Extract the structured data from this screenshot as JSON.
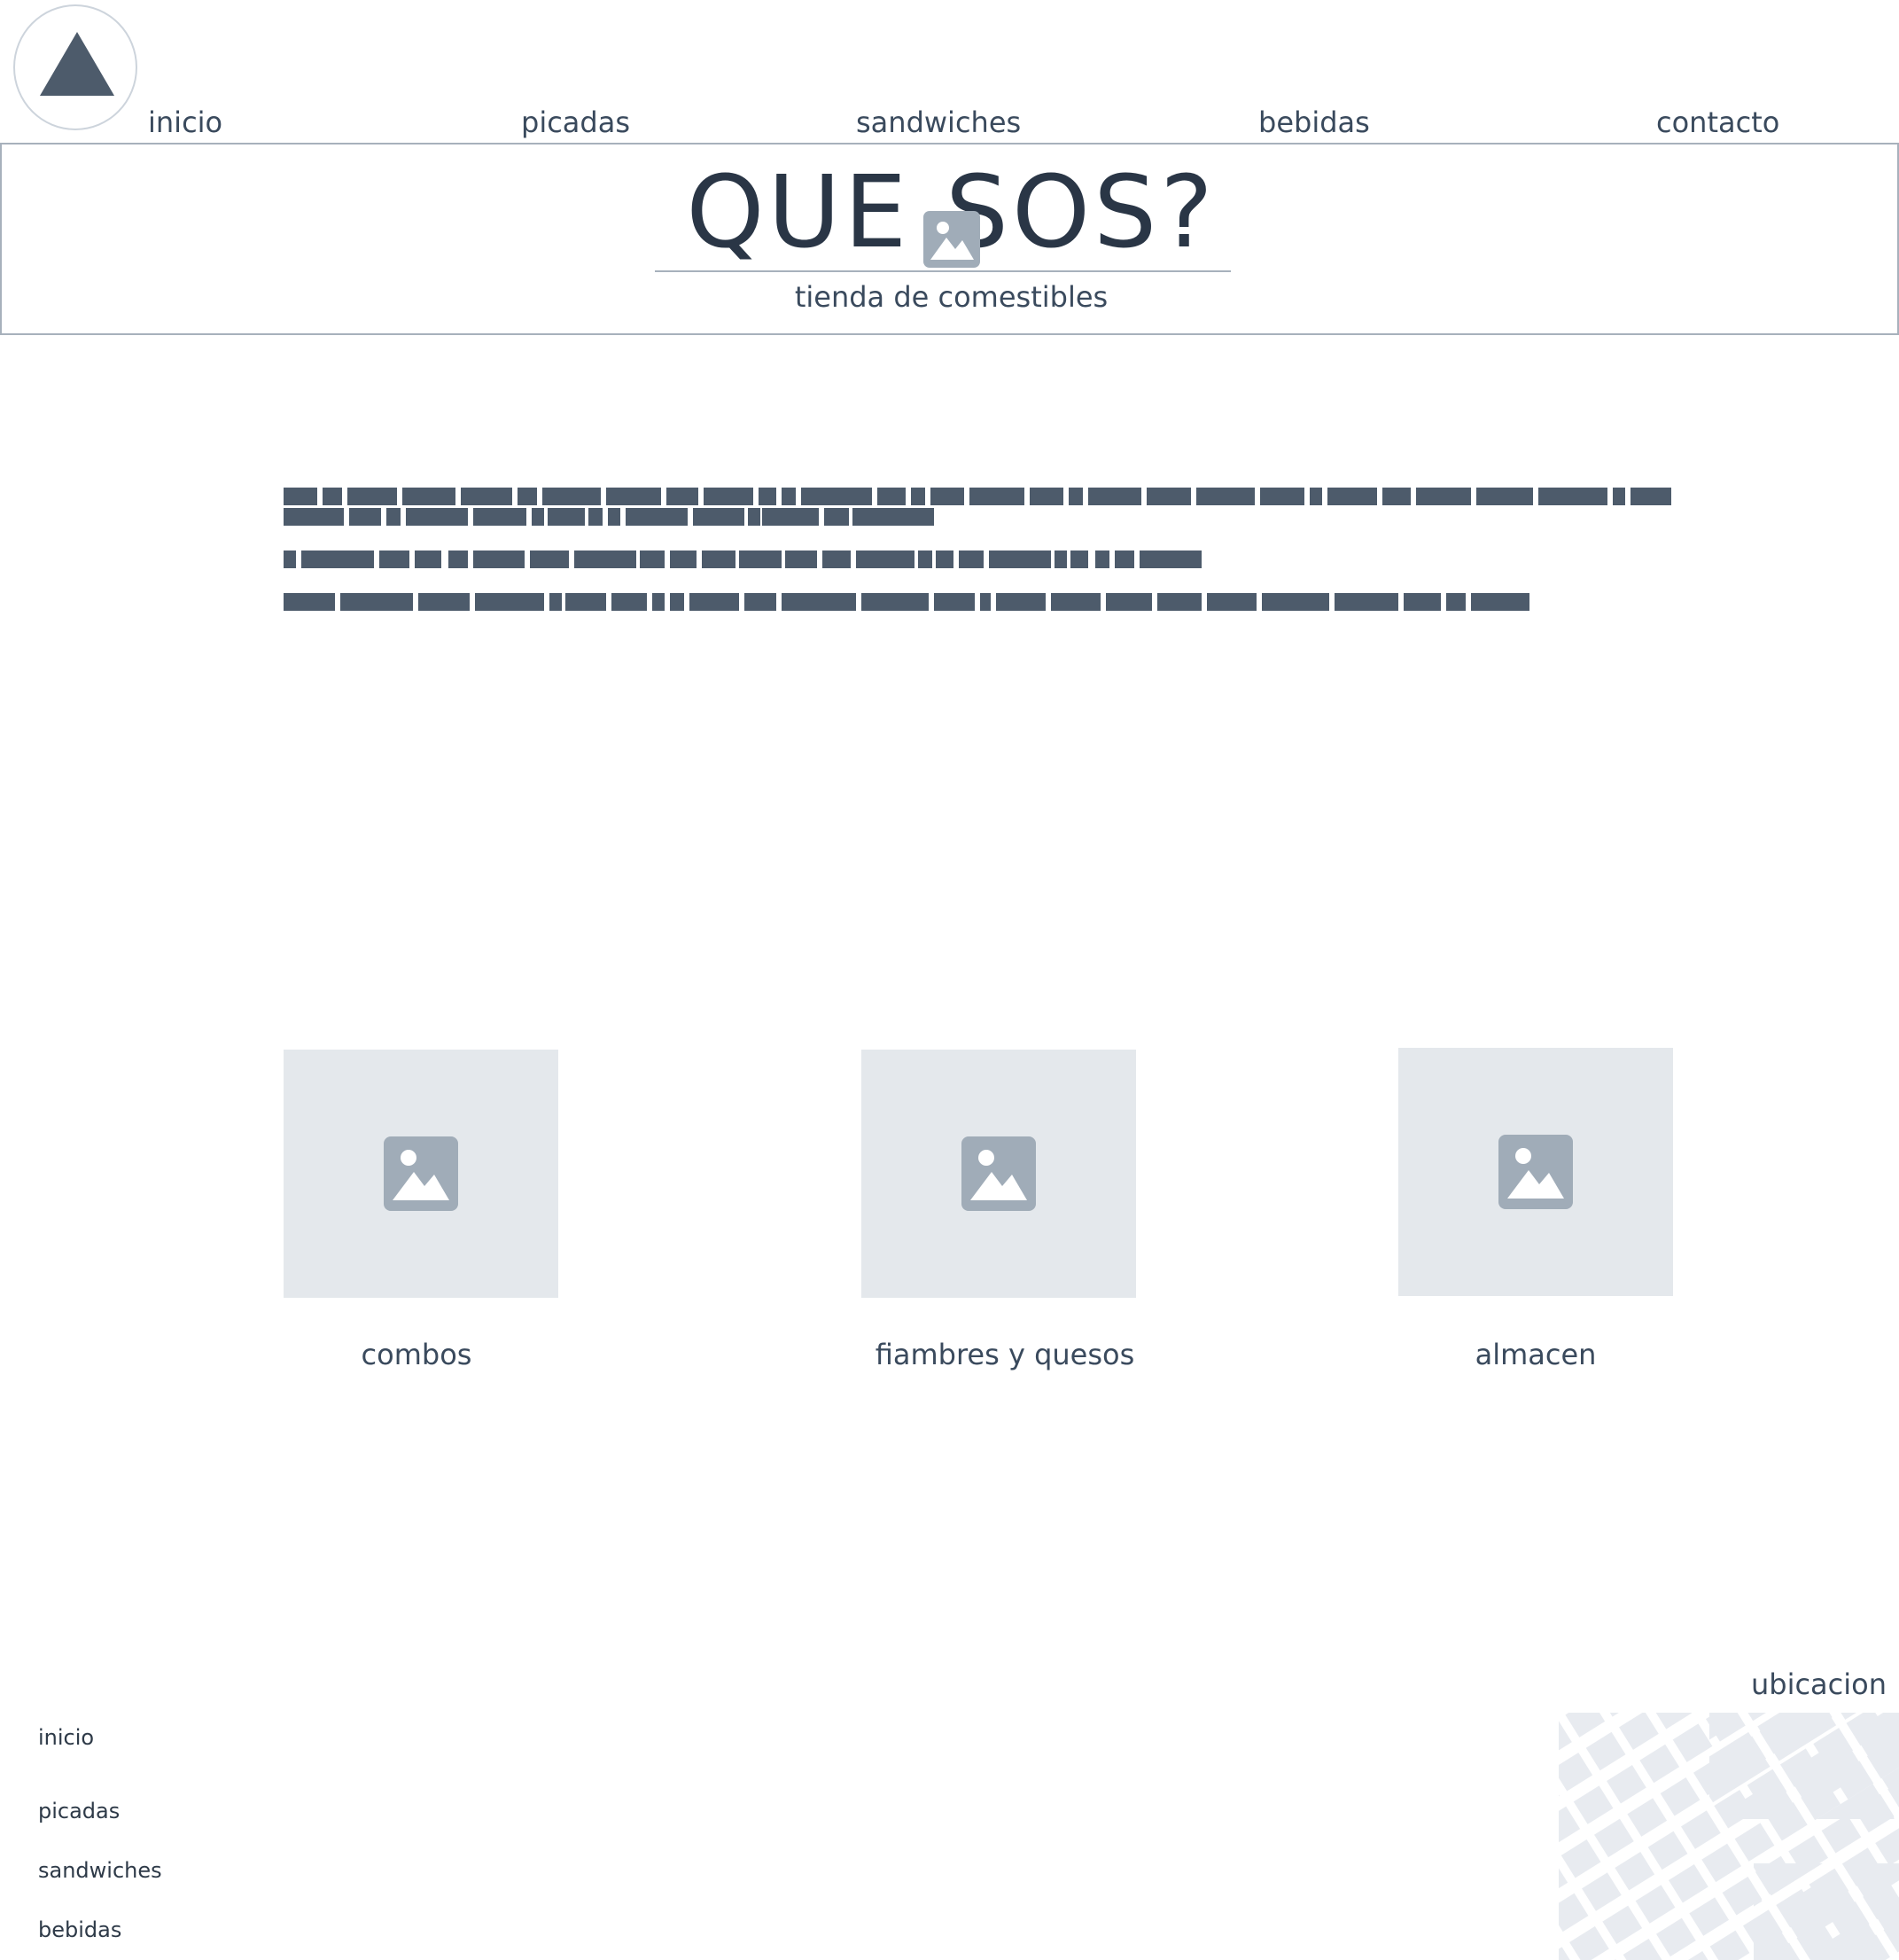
{
  "header": {
    "logo_icon": "triangle-icon",
    "nav": [
      {
        "label": "inicio"
      },
      {
        "label": "picadas"
      },
      {
        "label": "sandwiches"
      },
      {
        "label": "bebidas"
      },
      {
        "label": "contacto"
      }
    ]
  },
  "hero": {
    "title": "QUE SOS?",
    "subtitle": "tienda de comestibles",
    "icon": "image-placeholder-icon"
  },
  "categories": [
    {
      "label": "combos",
      "icon": "image-placeholder-icon"
    },
    {
      "label": "fiambres y quesos",
      "icon": "image-placeholder-icon"
    },
    {
      "label": "almacen",
      "icon": "image-placeholder-icon"
    }
  ],
  "footer": {
    "links": [
      {
        "label": "inicio"
      },
      {
        "label": "picadas"
      },
      {
        "label": "sandwiches"
      },
      {
        "label": "bebidas"
      }
    ],
    "map_title": "ubicacion",
    "map_icon": "map-placeholder"
  },
  "colors": {
    "text": "#2b3746",
    "accent": "#4d5b6b",
    "placeholder_bg": "#e4e8ec",
    "placeholder_icon": "#a0acb8",
    "border": "#a7b1bc"
  }
}
